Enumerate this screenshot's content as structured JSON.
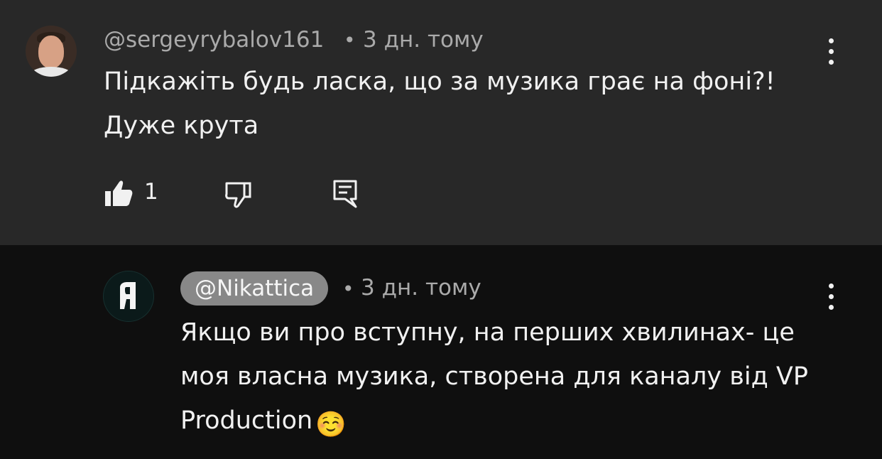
{
  "comment": {
    "author": "@sergeyrybalov161",
    "separator": "•",
    "time": "3 дн. тому",
    "text": "Підкажіть будь ласка, що за музика грає на фоні?! Дуже крута",
    "likes": "1"
  },
  "reply": {
    "author": "@Nikattica",
    "separator": "•",
    "time": "3 дн. тому",
    "text": "Якщо ви про вступну, на перших хвилинах- це моя власна музика, створена для каналу від VP Production",
    "emoji": "☺️"
  },
  "icons": {
    "like": "thumbs-up-icon",
    "dislike": "thumbs-down-icon",
    "reply": "reply-icon",
    "more": "more-vertical-icon"
  },
  "colors": {
    "comment_bg": "#282828",
    "reply_bg": "#0f0f0f",
    "primary_text": "#f1f1f1",
    "secondary_text": "#aaaaaa",
    "chip_bg": "#888888"
  }
}
